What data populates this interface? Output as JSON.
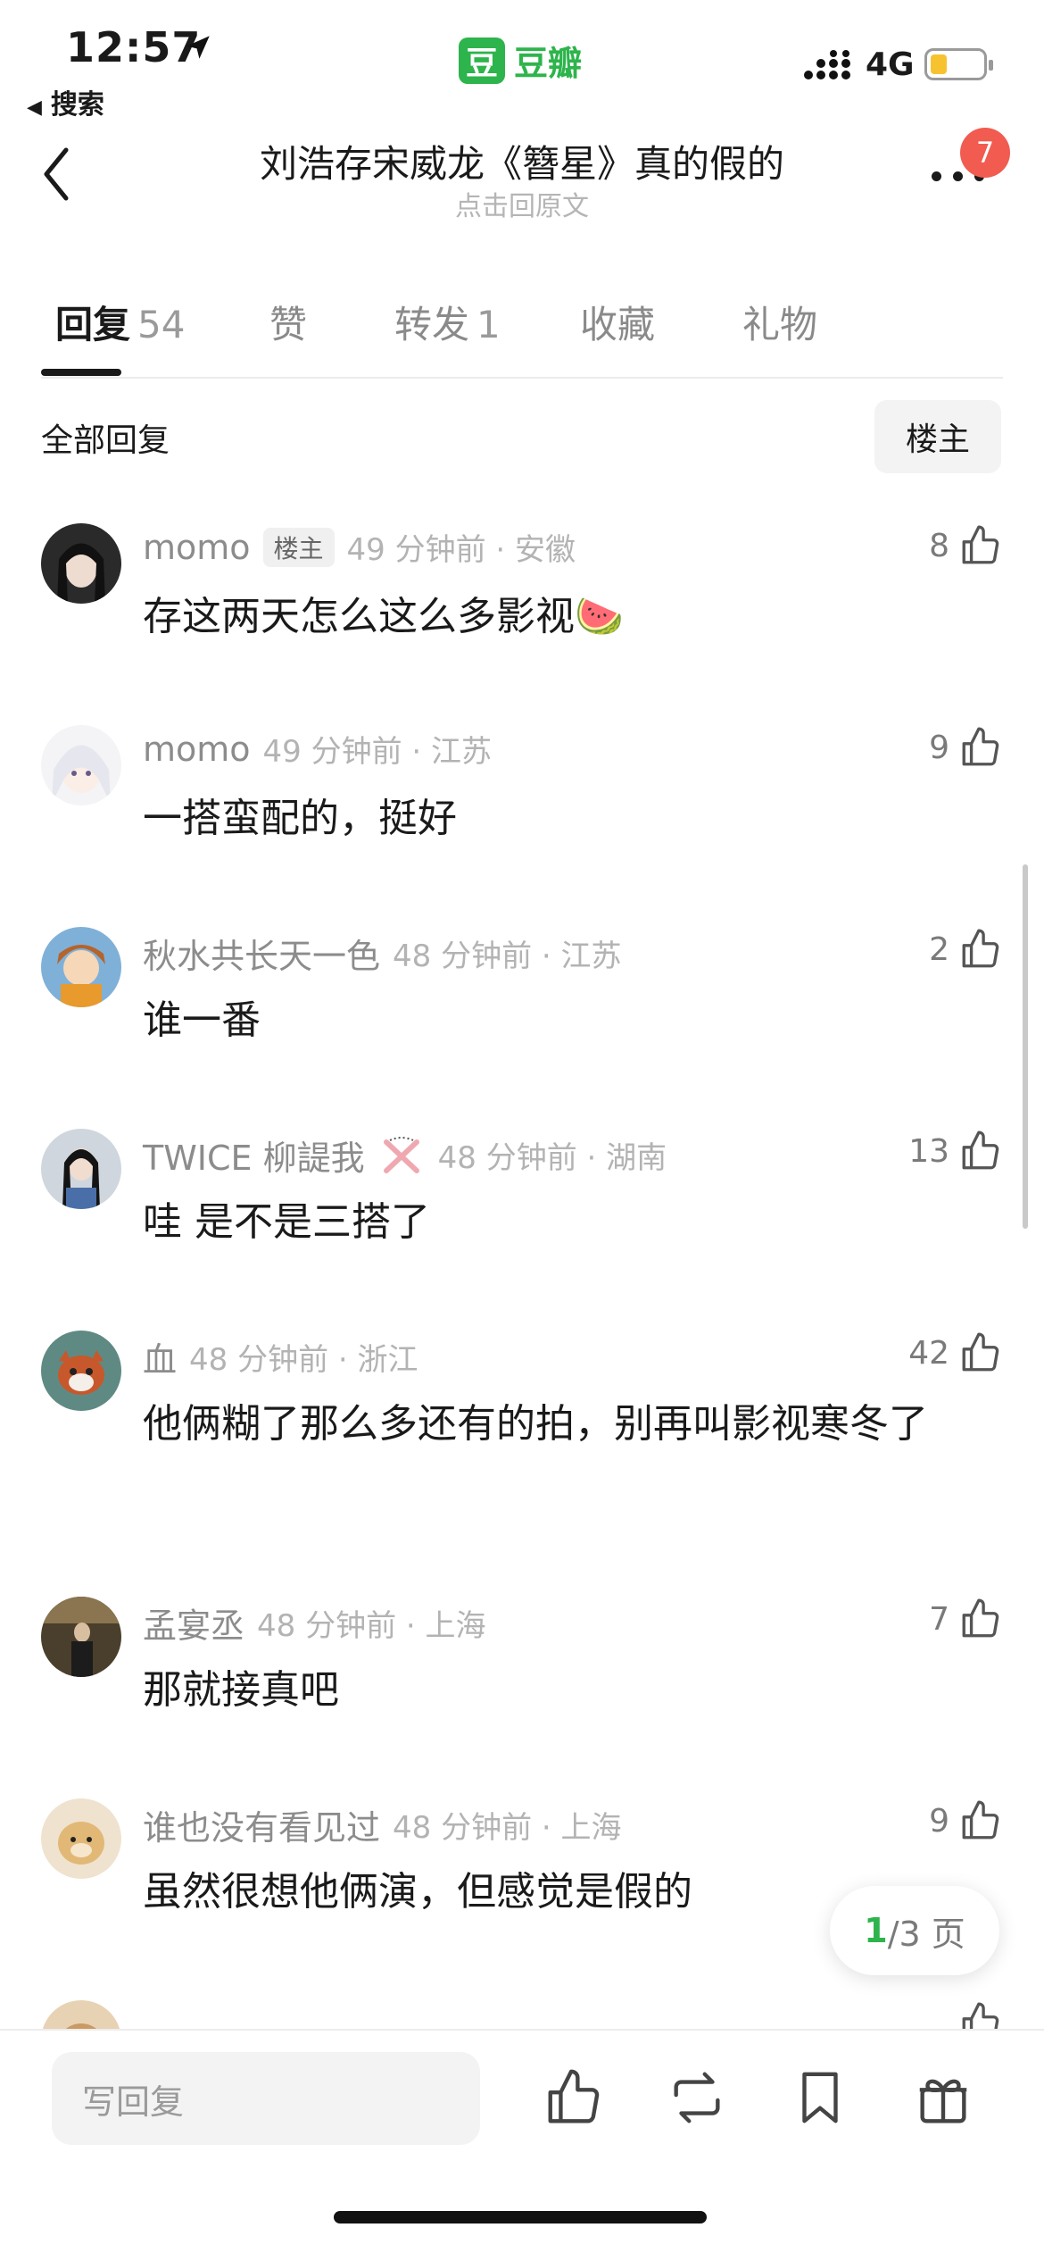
{
  "status_bar": {
    "time": "12:57",
    "back_app": "搜索",
    "app_logo_char": "豆",
    "app_name": "豆瓣",
    "network": "4G"
  },
  "nav": {
    "title": "刘浩存宋威龙《簪星》真的假的",
    "subtitle": "点击回原文",
    "notification_count": "7"
  },
  "tabs": [
    {
      "label": "回复",
      "count": "54",
      "active": true
    },
    {
      "label": "赞",
      "count": ""
    },
    {
      "label": "转发",
      "count": "1"
    },
    {
      "label": "收藏",
      "count": ""
    },
    {
      "label": "礼物",
      "count": ""
    }
  ],
  "section": {
    "title": "全部回复",
    "filter_label": "楼主"
  },
  "comments": [
    {
      "author": "momo",
      "badge": "楼主",
      "time_place": "49 分钟前 · 安徽",
      "text": "存这两天怎么这么多影视🍉",
      "likes": "8"
    },
    {
      "author": "momo",
      "badge": "",
      "time_place": "49 分钟前 · 江苏",
      "text": "一搭蛮配的，挺好",
      "likes": "9"
    },
    {
      "author": "秋水共长天一色",
      "badge": "",
      "time_place": "48 分钟前 · 江苏",
      "text": "谁一番",
      "likes": "2"
    },
    {
      "author": "TWICE 柳諟我",
      "badge": "",
      "time_place": "48 分钟前 · 湖南",
      "text": "哇 是不是三搭了",
      "likes": "13"
    },
    {
      "author": "血",
      "badge": "",
      "time_place": "48 分钟前 · 浙江",
      "text": "他俩糊了那么多还有的拍，别再叫影视寒冬了",
      "likes": "42"
    },
    {
      "author": "孟宴丞",
      "badge": "",
      "time_place": "48 分钟前 · 上海",
      "text": "那就接真吧",
      "likes": "7"
    },
    {
      "author": "谁也没有看见过",
      "badge": "",
      "time_place": "48 分钟前 · 上海",
      "text": "虽然很想他俩演，但感觉是假的",
      "likes": "9"
    }
  ],
  "pagination": {
    "current": "1",
    "total_text": "/3 页"
  },
  "bottom_bar": {
    "reply_placeholder": "写回复"
  },
  "colors": {
    "accent": "#2db44c",
    "badge_red": "#f15b50",
    "battery": "#f6c230"
  }
}
